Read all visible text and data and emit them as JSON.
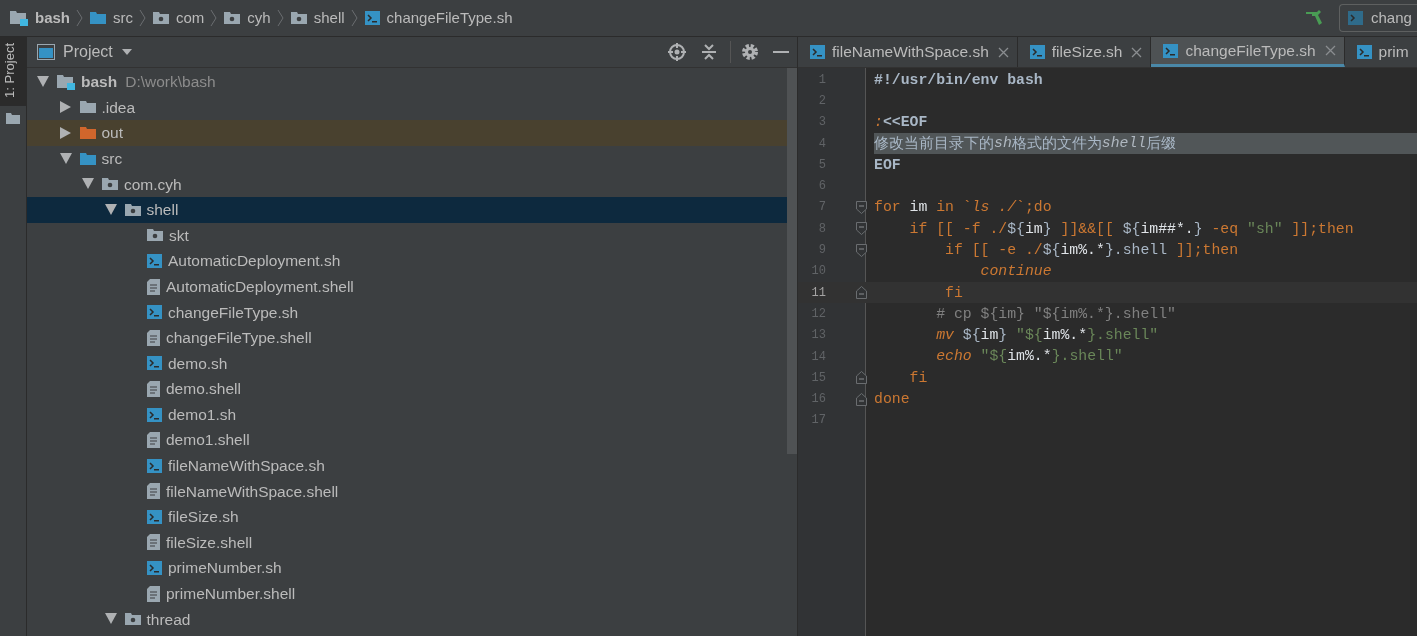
{
  "breadcrumb": [
    {
      "label": "bash",
      "kind": "project"
    },
    {
      "label": "src",
      "kind": "source"
    },
    {
      "label": "com",
      "kind": "package"
    },
    {
      "label": "cyh",
      "kind": "package"
    },
    {
      "label": "shell",
      "kind": "package"
    },
    {
      "label": "changeFileType.sh",
      "kind": "sh"
    }
  ],
  "run_config": {
    "label": "chang"
  },
  "side_tab": {
    "label": "1: Project",
    "selected": true
  },
  "project_panel": {
    "title": "Project"
  },
  "tree": [
    {
      "label": "bash",
      "path": "D:\\work\\bash",
      "kind": "project",
      "expanded": true,
      "selected": false,
      "children": [
        {
          "label": ".idea",
          "kind": "folder",
          "expanded": false,
          "selected": false
        },
        {
          "label": "out",
          "kind": "excluded",
          "expanded": false,
          "selected": false
        },
        {
          "label": "src",
          "kind": "source",
          "expanded": true,
          "selected": false,
          "children": [
            {
              "label": "com.cyh",
              "kind": "package",
              "expanded": true,
              "selected": false,
              "children": [
                {
                  "label": "shell",
                  "kind": "package",
                  "expanded": true,
                  "selected": true,
                  "children": [
                    {
                      "label": "skt",
                      "kind": "package",
                      "selected": false
                    },
                    {
                      "label": "AutomaticDeployment.sh",
                      "kind": "sh",
                      "selected": false
                    },
                    {
                      "label": "AutomaticDeployment.shell",
                      "kind": "shell",
                      "selected": false
                    },
                    {
                      "label": "changeFileType.sh",
                      "kind": "sh",
                      "selected": false
                    },
                    {
                      "label": "changeFileType.shell",
                      "kind": "shell",
                      "selected": false
                    },
                    {
                      "label": "demo.sh",
                      "kind": "sh",
                      "selected": false
                    },
                    {
                      "label": "demo.shell",
                      "kind": "shell",
                      "selected": false
                    },
                    {
                      "label": "demo1.sh",
                      "kind": "sh",
                      "selected": false
                    },
                    {
                      "label": "demo1.shell",
                      "kind": "shell",
                      "selected": false
                    },
                    {
                      "label": "fileNameWithSpace.sh",
                      "kind": "sh",
                      "selected": false
                    },
                    {
                      "label": "fileNameWithSpace.shell",
                      "kind": "shell",
                      "selected": false
                    },
                    {
                      "label": "fileSize.sh",
                      "kind": "sh",
                      "selected": false
                    },
                    {
                      "label": "fileSize.shell",
                      "kind": "shell",
                      "selected": false
                    },
                    {
                      "label": "primeNumber.sh",
                      "kind": "sh",
                      "selected": false
                    },
                    {
                      "label": "primeNumber.shell",
                      "kind": "shell",
                      "selected": false
                    }
                  ]
                },
                {
                  "label": "thread",
                  "kind": "package",
                  "expanded": true,
                  "selected": false
                }
              ]
            }
          ]
        }
      ]
    }
  ],
  "tabs": [
    {
      "label": "fileNameWithSpace.sh",
      "selected": false,
      "closable": true
    },
    {
      "label": "fileSize.sh",
      "selected": false,
      "closable": true
    },
    {
      "label": "changeFileType.sh",
      "selected": true,
      "closable": true
    },
    {
      "label": "prim",
      "selected": false,
      "closable": false
    }
  ],
  "code_lines": [
    {
      "number": "1",
      "kind": "plain",
      "selected": false,
      "caret": false,
      "tokens": [
        {
          "text": "#!/usr/bin/env bash",
          "kind": "shebang"
        }
      ]
    },
    {
      "number": "2",
      "kind": "plain",
      "selected": false,
      "caret": false
    },
    {
      "number": "3",
      "kind": "plain",
      "selected": false,
      "caret": false,
      "tokens": [
        {
          "text": ":",
          "kind": "italic"
        },
        {
          "text": "<<EOF",
          "kind": "bold"
        }
      ]
    },
    {
      "number": "4",
      "kind": "plain",
      "selected": true,
      "caret": false,
      "tokens": [
        {
          "text": "修改当前目录下的",
          "kind": "plain"
        },
        {
          "text": "sh",
          "kind": "emph"
        },
        {
          "text": "格式的文件为",
          "kind": "plain"
        },
        {
          "text": "shell",
          "kind": "emph"
        },
        {
          "text": "后缀",
          "kind": "plain"
        }
      ]
    },
    {
      "number": "5",
      "kind": "plain",
      "selected": false,
      "caret": false,
      "tokens": [
        {
          "text": "EOF",
          "kind": "bold"
        }
      ]
    },
    {
      "number": "6",
      "kind": "plain",
      "selected": false,
      "caret": false
    },
    {
      "number": "7",
      "kind": "fold_start",
      "selected": false,
      "caret": false,
      "tokens": [
        {
          "text": "for",
          "kind": "keyword"
        },
        {
          "text": " im ",
          "kind": "var"
        },
        {
          "text": "in `",
          "kind": "keyword"
        },
        {
          "text": "ls ./",
          "kind": "italic"
        },
        {
          "text": "`;do",
          "kind": "keyword"
        }
      ]
    },
    {
      "number": "8",
      "kind": "fold_start",
      "selected": false,
      "caret": false,
      "tokens": [
        {
          "text": "    if [[ -f ./",
          "kind": "keyword"
        },
        {
          "text": "${",
          "kind": "plain"
        },
        {
          "text": "im",
          "kind": "var"
        },
        {
          "text": "}",
          "kind": "plain"
        },
        {
          "text": " ]]&&[[ ",
          "kind": "keyword"
        },
        {
          "text": "${",
          "kind": "plain"
        },
        {
          "text": "im##*.",
          "kind": "var"
        },
        {
          "text": "}",
          "kind": "plain"
        },
        {
          "text": " -eq ",
          "kind": "keyword"
        },
        {
          "text": "\"sh\"",
          "kind": "string"
        },
        {
          "text": " ]];then",
          "kind": "keyword"
        }
      ]
    },
    {
      "number": "9",
      "kind": "fold_start",
      "selected": false,
      "caret": false,
      "tokens": [
        {
          "text": "        if [[ -e ./",
          "kind": "keyword"
        },
        {
          "text": "${",
          "kind": "plain"
        },
        {
          "text": "im%.*",
          "kind": "var"
        },
        {
          "text": "}.shell",
          "kind": "plain"
        },
        {
          "text": " ]];then",
          "kind": "keyword"
        }
      ]
    },
    {
      "number": "10",
      "kind": "plain",
      "selected": false,
      "caret": false,
      "tokens": [
        {
          "text": "            continue",
          "kind": "italic"
        }
      ]
    },
    {
      "number": "11",
      "kind": "fold_end",
      "selected": false,
      "caret": true,
      "tokens": [
        {
          "text": "        fi",
          "kind": "keyword"
        }
      ]
    },
    {
      "number": "12",
      "kind": "plain",
      "selected": false,
      "caret": false,
      "tokens": [
        {
          "text": "       # cp ${im} \"${im%.*}.shell\"",
          "kind": "comment"
        }
      ]
    },
    {
      "number": "13",
      "kind": "plain",
      "selected": false,
      "caret": false,
      "tokens": [
        {
          "text": "       mv",
          "kind": "italic"
        },
        {
          "text": " ${",
          "kind": "plain"
        },
        {
          "text": "im",
          "kind": "var"
        },
        {
          "text": "} ",
          "kind": "plain"
        },
        {
          "text": "\"${",
          "kind": "string"
        },
        {
          "text": "im%.*",
          "kind": "var"
        },
        {
          "text": "}.shell\"",
          "kind": "string"
        }
      ]
    },
    {
      "number": "14",
      "kind": "plain",
      "selected": false,
      "caret": false,
      "tokens": [
        {
          "text": "       echo",
          "kind": "italic"
        },
        {
          "text": " \"${",
          "kind": "string"
        },
        {
          "text": "im%.*",
          "kind": "var"
        },
        {
          "text": "}.shell\"",
          "kind": "string"
        }
      ]
    },
    {
      "number": "15",
      "kind": "fold_end",
      "selected": false,
      "caret": false,
      "tokens": [
        {
          "text": "    fi",
          "kind": "keyword"
        }
      ]
    },
    {
      "number": "16",
      "kind": "fold_end",
      "selected": false,
      "caret": false,
      "tokens": [
        {
          "text": "done",
          "kind": "keyword"
        }
      ]
    },
    {
      "number": "17",
      "kind": "plain",
      "selected": false,
      "caret": false
    }
  ]
}
